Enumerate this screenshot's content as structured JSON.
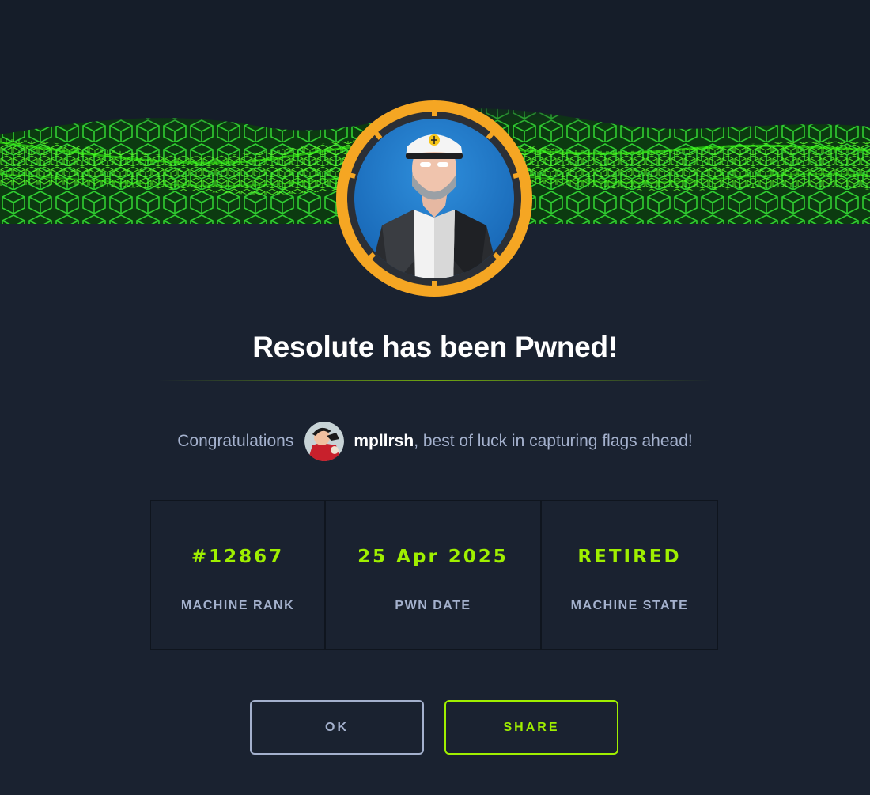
{
  "machine": {
    "name": "Resolute",
    "title": "Resolute has been Pwned!"
  },
  "congrats": {
    "prefix": "Congratulations",
    "username": "mpllrsh",
    "suffix": ", best of luck in capturing flags ahead!"
  },
  "stats": [
    {
      "value": "#12867",
      "label": "MACHINE RANK"
    },
    {
      "value": "25 Apr 2025",
      "label": "PWN DATE"
    },
    {
      "value": "RETIRED",
      "label": "MACHINE STATE"
    }
  ],
  "buttons": {
    "ok": "OK",
    "share": "SHARE"
  },
  "colors": {
    "accent": "#9fef00",
    "background": "#1a2230",
    "avatar_ring": "#f5a623",
    "muted_text": "#a4b1cd"
  }
}
